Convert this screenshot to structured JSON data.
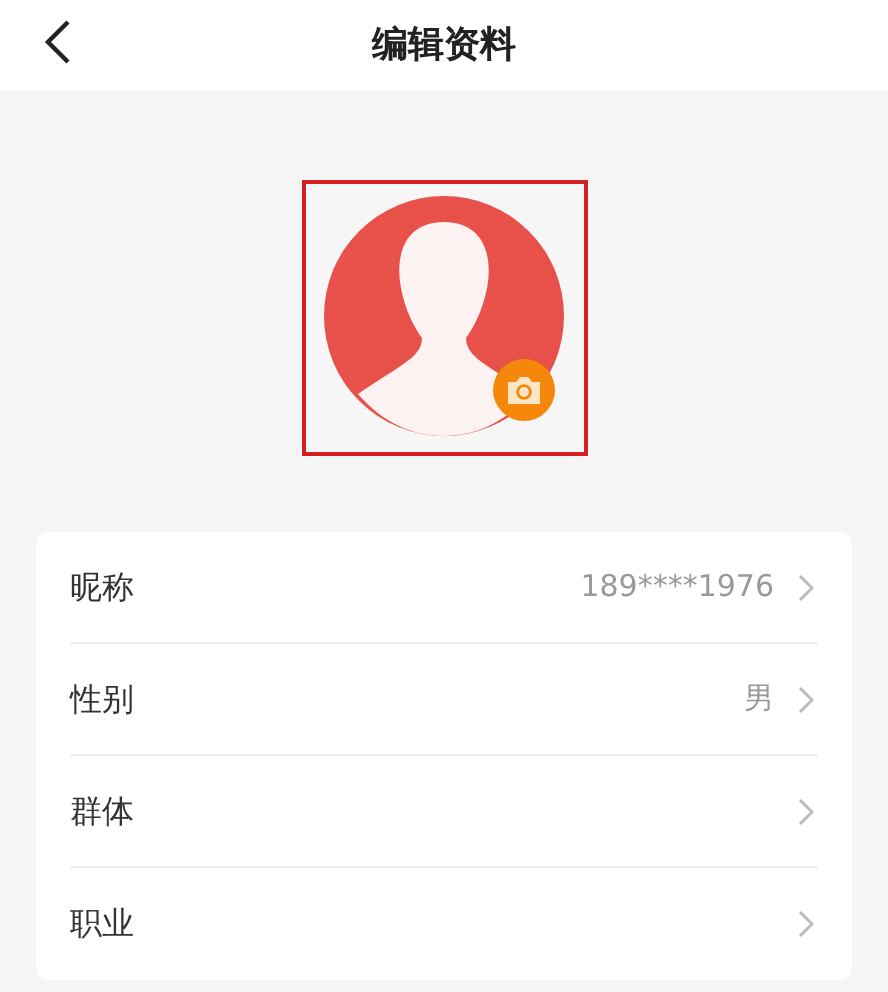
{
  "header": {
    "title": "编辑资料"
  },
  "profile_fields": [
    {
      "label": "昵称",
      "value": "189****1976"
    },
    {
      "label": "性别",
      "value": "男"
    },
    {
      "label": "群体"
    },
    {
      "label": "职业"
    }
  ]
}
